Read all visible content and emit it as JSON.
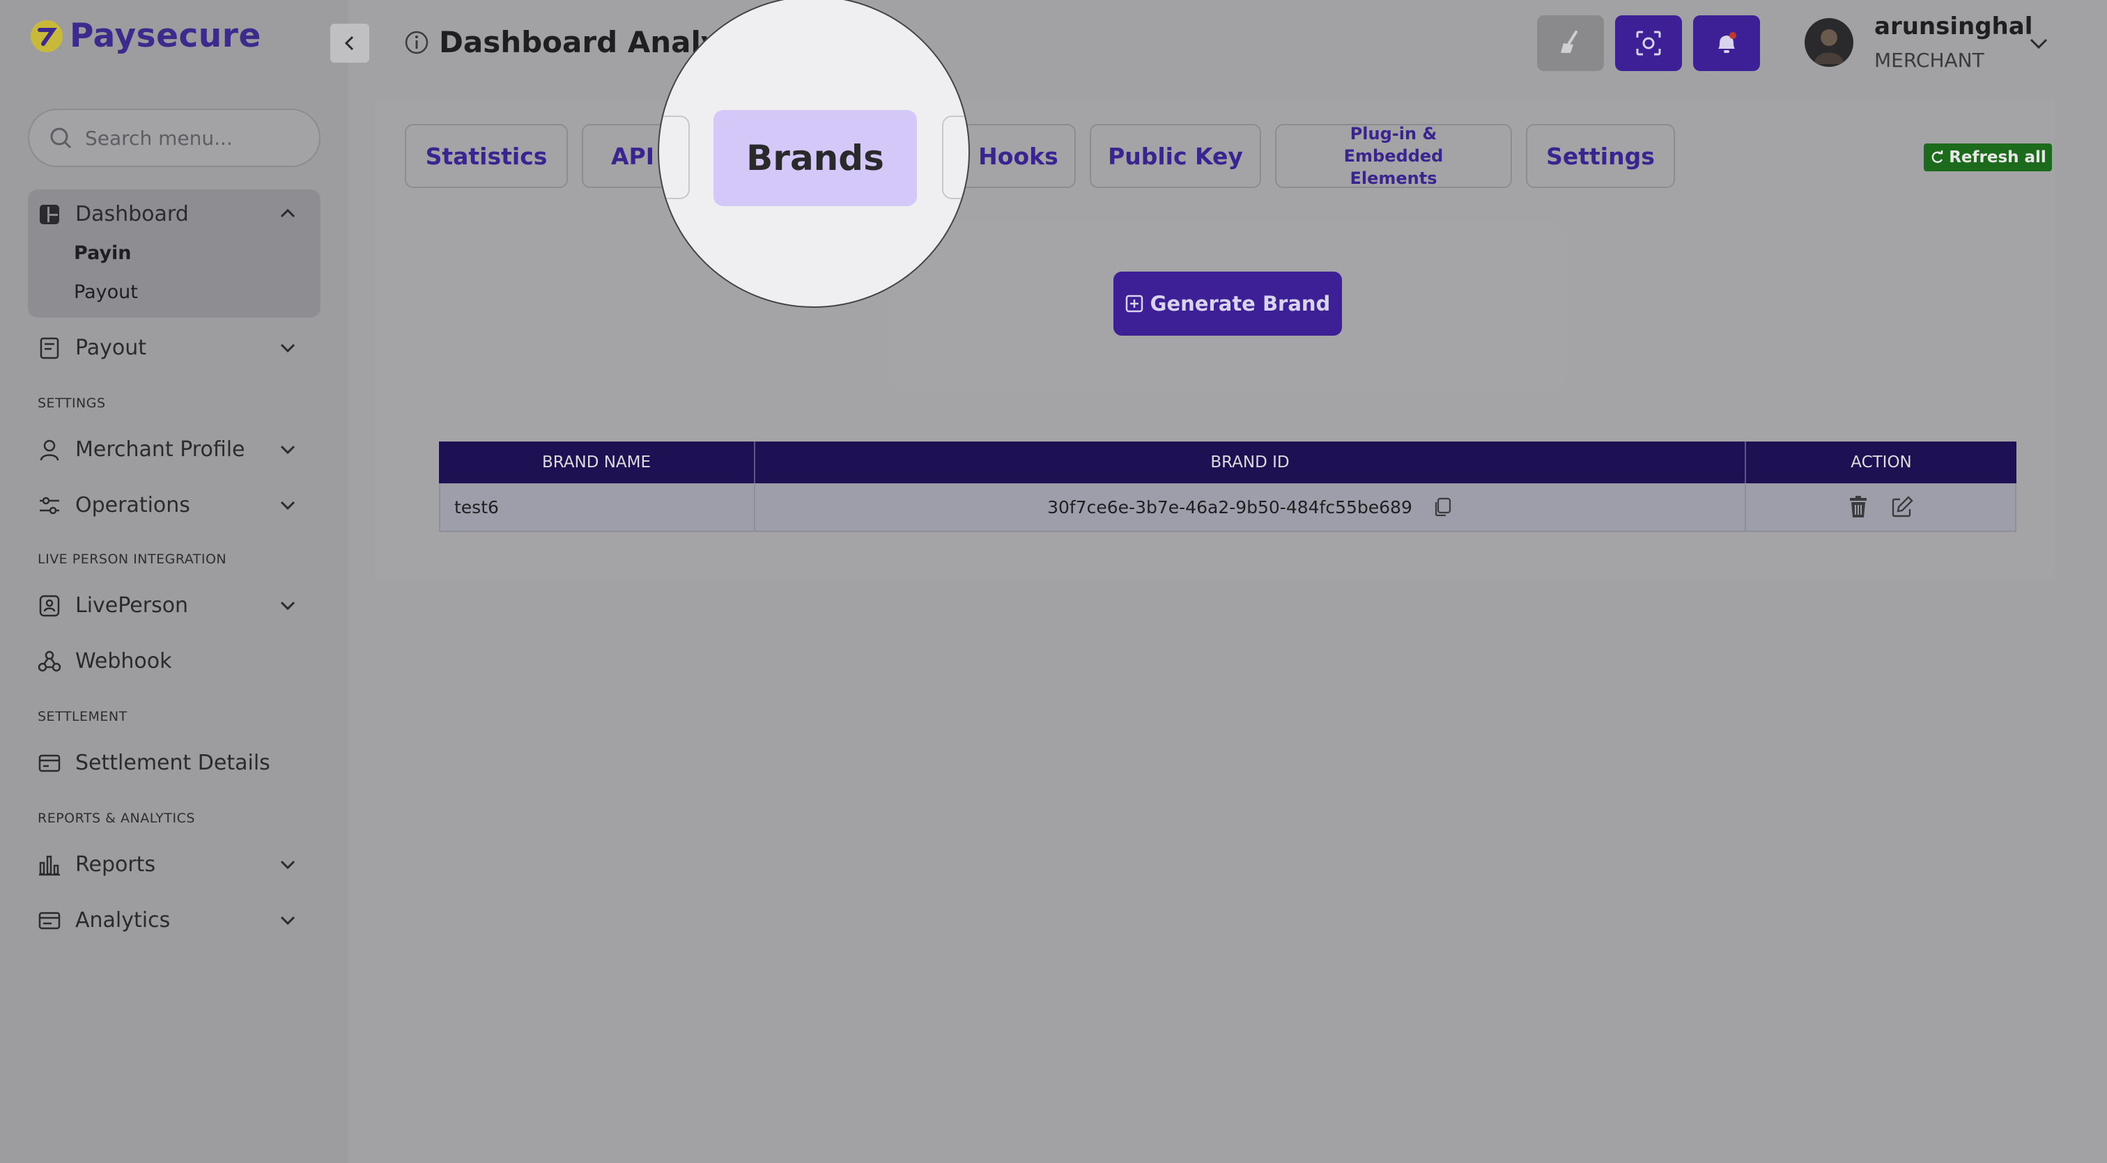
{
  "brand": {
    "name": "Paysecure"
  },
  "sidebar": {
    "search_placeholder": "Search menu...",
    "dashboard": {
      "label": "Dashboard",
      "children": [
        "Payin",
        "Payout"
      ]
    },
    "payout": "Payout",
    "sections": {
      "settings": "SETTINGS",
      "live_person": "LIVE PERSON INTEGRATION",
      "settlement": "SETTLEMENT",
      "reports": "REPORTS & ANALYTICS"
    },
    "merchant_profile": "Merchant Profile",
    "operations": "Operations",
    "liveperson": "LivePerson",
    "webhook": "Webhook",
    "settlement_details": "Settlement Details",
    "reports": "Reports",
    "analytics": "Analytics"
  },
  "header": {
    "title": "Dashboard Analytic",
    "user_name": "arunsinghal",
    "user_role": "MERCHANT"
  },
  "tabs": {
    "statistics": "Statistics",
    "api": "API K",
    "brands": "Brands",
    "hooks": "o Hooks",
    "public_key": "Public Key",
    "plugin": "Plug-in & Embedded Elements",
    "settings": "Settings"
  },
  "refresh_label": "Refresh all",
  "generate_label": "Generate Brand",
  "table": {
    "headers": [
      "BRAND NAME",
      "BRAND ID",
      "ACTION"
    ],
    "rows": [
      {
        "name": "test6",
        "id": "30f7ce6e-3b7e-46a2-9b50-484fc55be689"
      }
    ]
  },
  "colors": {
    "primary": "#3d2096",
    "header_bg": "#1d1153",
    "refresh": "#1c6b1c",
    "highlight": "#d4c8f8"
  }
}
